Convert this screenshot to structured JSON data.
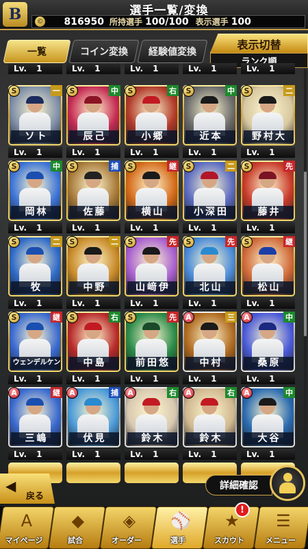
{
  "header": {
    "logo": "B",
    "title": "選手一覧/変換",
    "coins": "816950",
    "owned_label": "所持選手",
    "owned_value": "100/100",
    "display_label": "表示選手",
    "display_value": "100"
  },
  "tabs": [
    {
      "label": "一覧",
      "active": true
    },
    {
      "label": "コイン変換",
      "active": false
    },
    {
      "label": "経験値変換",
      "active": false
    }
  ],
  "display_switch": {
    "label": "表示切替",
    "sort": "ランク順"
  },
  "level_label": "Lv.",
  "top_partial_levels": [
    "1",
    "1",
    "1",
    "1",
    "1"
  ],
  "rows": [
    [
      {
        "rank": "S",
        "pos": "一",
        "name": "ソト",
        "level": "1",
        "cap": "#1c2c5c",
        "bg": "#7f8fa8"
      },
      {
        "rank": "S",
        "pos": "中",
        "name": "辰己",
        "level": "1",
        "cap": "#8b1424",
        "bg": "#c52b53"
      },
      {
        "rank": "S",
        "pos": "右",
        "name": "小郷",
        "level": "1",
        "cap": "#c21a22",
        "bg": "#b13a2a"
      },
      {
        "rank": "S",
        "pos": "中",
        "name": "近本",
        "level": "1",
        "cap": "#1a1a1a",
        "bg": "#6b6b6b"
      },
      {
        "rank": "S",
        "pos": "二",
        "name": "野村大",
        "level": "1",
        "cap": "#1a1a1a",
        "bg": "#d8c8a0"
      }
    ],
    [
      {
        "rank": "S",
        "pos": "中",
        "name": "岡林",
        "level": "1",
        "cap": "#1a4fb0",
        "bg": "#3d74d6"
      },
      {
        "rank": "S",
        "pos": "捕",
        "name": "佐藤",
        "level": "1",
        "cap": "#222222",
        "bg": "#a87a3a"
      },
      {
        "rank": "S",
        "pos": "継",
        "name": "横山",
        "level": "1",
        "cap": "#1a1a1a",
        "bg": "#d46a1a"
      },
      {
        "rank": "S",
        "pos": "二",
        "name": "小深田",
        "level": "1",
        "cap": "#b1162a",
        "bg": "#5a6ac0"
      },
      {
        "rank": "S",
        "pos": "先",
        "name": "藤井",
        "level": "1",
        "cap": "#7a1424",
        "bg": "#c83a2a"
      }
    ],
    [
      {
        "rank": "S",
        "pos": "二",
        "name": "牧",
        "level": "1",
        "cap": "#1a4fb0",
        "bg": "#2f6ac8"
      },
      {
        "rank": "S",
        "pos": "二",
        "name": "中野",
        "level": "1",
        "cap": "#1a1a1a",
        "bg": "#c88a2a"
      },
      {
        "rank": "S",
        "pos": "先",
        "name": "山﨑伊",
        "level": "1",
        "cap": "#1a1a1a",
        "bg": "#a860d0"
      },
      {
        "rank": "S",
        "pos": "先",
        "name": "北山",
        "level": "1",
        "cap": "#2a8ad0",
        "bg": "#4a8ad8"
      },
      {
        "rank": "S",
        "pos": "継",
        "name": "松山",
        "level": "1",
        "cap": "#1a3ea8",
        "bg": "#d06a3a"
      }
    ],
    [
      {
        "rank": "S",
        "pos": "継",
        "name": "ウェンデルケン",
        "level": "1",
        "cap": "#1a4fb0",
        "bg": "#3a6ad0",
        "small": true
      },
      {
        "rank": "S",
        "pos": "右",
        "name": "中島",
        "level": "1",
        "cap": "#c21a22",
        "bg": "#b82a2a"
      },
      {
        "rank": "S",
        "pos": "先",
        "name": "前田悠",
        "level": "1",
        "cap": "#1a4a2a",
        "bg": "#2a8a4a"
      },
      {
        "rank": "A",
        "pos": "三",
        "name": "中村",
        "level": "1",
        "cap": "#1a1a1a",
        "bg": "#b06a20"
      },
      {
        "rank": "A",
        "pos": "中",
        "name": "桑原",
        "level": "1",
        "cap": "#1a2a80",
        "bg": "#4a5ad8"
      }
    ],
    [
      {
        "rank": "A",
        "pos": "継",
        "name": "三嶋",
        "level": "1",
        "cap": "#1a4fb0",
        "bg": "#3a6ad0"
      },
      {
        "rank": "A",
        "pos": "捕",
        "name": "伏見",
        "level": "1",
        "cap": "#2a8ad0",
        "bg": "#4a9ad8"
      },
      {
        "rank": "A",
        "pos": "右",
        "name": "鈴木",
        "level": "1",
        "cap": "#c21a22",
        "bg": "#d8c8b0"
      },
      {
        "rank": "A",
        "pos": "右",
        "name": "鈴木",
        "level": "1",
        "cap": "#c21a22",
        "bg": "#d0b890"
      },
      {
        "rank": "A",
        "pos": "中",
        "name": "大谷",
        "level": "1",
        "cap": "#1a1a1a",
        "bg": "#2a6ab0"
      }
    ]
  ],
  "bottom_partial_levels": [
    "1",
    "1",
    "1",
    "1",
    "1"
  ],
  "back_button": "戻る",
  "detail_button": "詳細確認",
  "scout_badge": "!",
  "nav": [
    {
      "label": "マイページ",
      "glyph": "A",
      "active": false
    },
    {
      "label": "試合",
      "glyph": "◆",
      "active": false
    },
    {
      "label": "オーダー",
      "glyph": "◈",
      "active": false
    },
    {
      "label": "選手",
      "glyph": "⚾",
      "active": true
    },
    {
      "label": "スカウト",
      "glyph": "★",
      "active": false
    },
    {
      "label": "メニュー",
      "glyph": "☰",
      "active": false
    }
  ]
}
